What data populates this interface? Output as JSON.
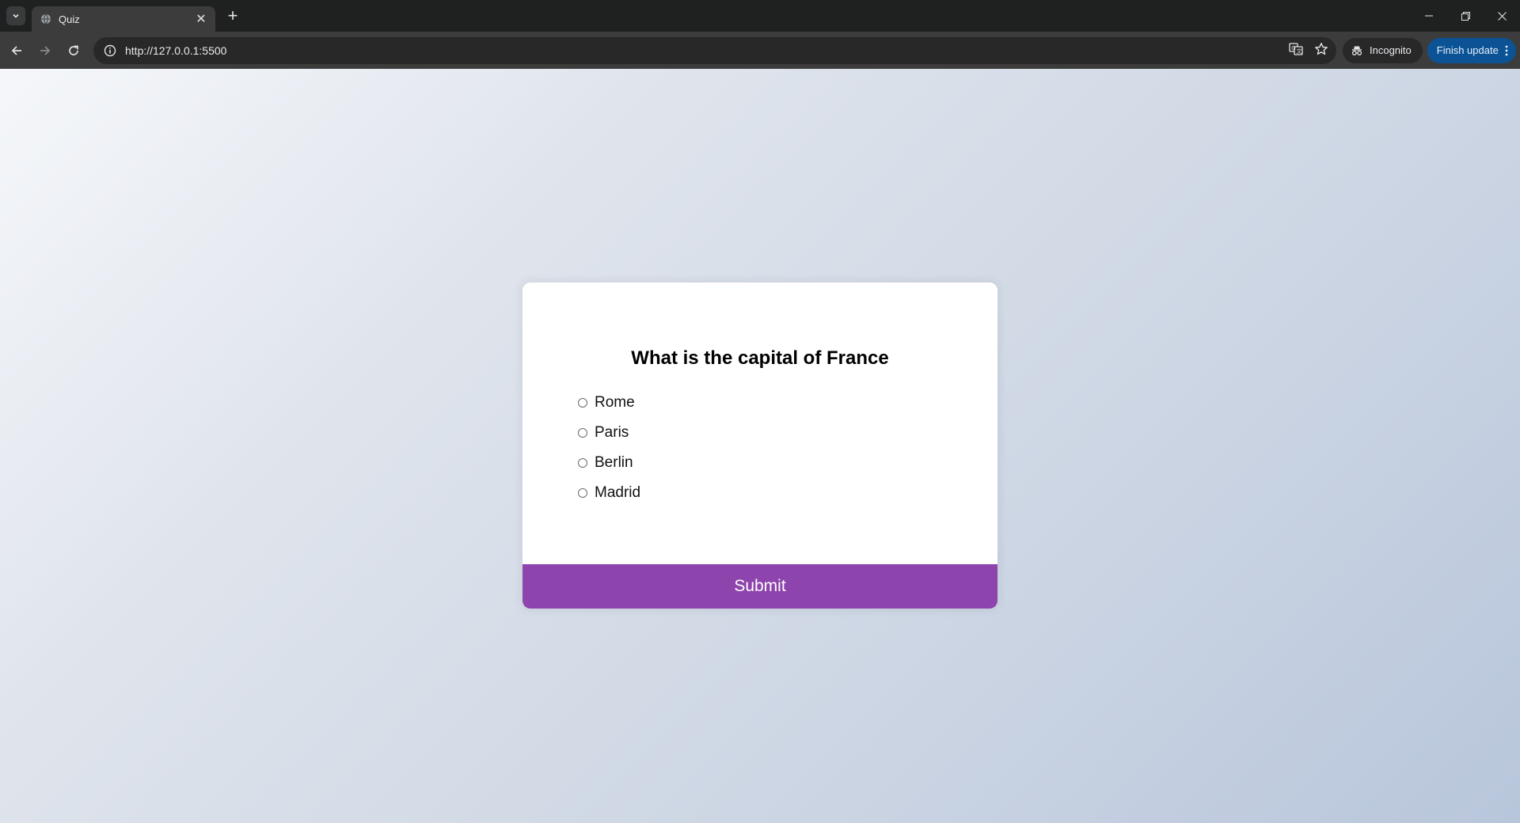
{
  "browser": {
    "tab": {
      "title": "Quiz",
      "favicon": "globe-icon"
    },
    "omnibox": {
      "url": "http://127.0.0.1:5500"
    },
    "incognito_label": "Incognito",
    "finish_update_label": "Finish update"
  },
  "quiz": {
    "question": "What is the capital of France",
    "answers": [
      "Rome",
      "Paris",
      "Berlin",
      "Madrid"
    ],
    "selected": null,
    "submit_label": "Submit"
  },
  "colors": {
    "submit_bg": "#8e44ad",
    "page_gradient_start": "#f5f7fa",
    "page_gradient_end": "#b8c6db"
  }
}
